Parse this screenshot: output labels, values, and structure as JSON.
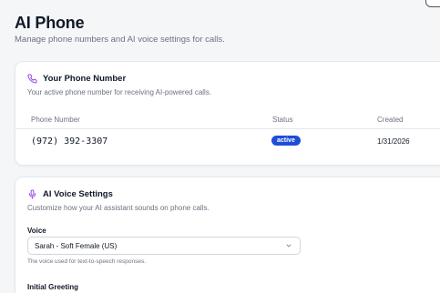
{
  "header": {
    "title": "AI Phone",
    "subtitle": "Manage phone numbers and AI voice settings for calls."
  },
  "phone_card": {
    "icon": "phone-icon",
    "title": "Your Phone Number",
    "description": "Your active phone number for receiving AI-powered calls.",
    "columns": [
      "Phone Number",
      "Status",
      "Created"
    ],
    "row": {
      "phone_number": "(972) 392-3307",
      "status": "active",
      "created": "1/31/2026"
    }
  },
  "voice_card": {
    "icon": "microphone-icon",
    "title": "AI Voice Settings",
    "description": "Customize how your AI assistant sounds on phone calls.",
    "voice_label": "Voice",
    "voice_selected": "Sarah - Soft Female (US)",
    "voice_hint": "The voice used for text-to-speech responses.",
    "greeting_label": "Initial Greeting"
  },
  "colors": {
    "accent": "#9333ea",
    "badge": "#1d4ed8"
  }
}
